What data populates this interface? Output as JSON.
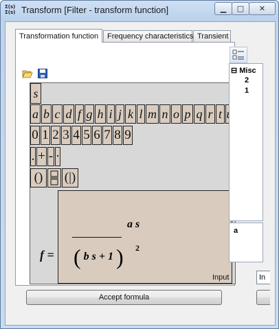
{
  "window": {
    "title": "Transform [Filter - transform function]",
    "app_icon": [
      "Σ(s)",
      "Σ(s)"
    ],
    "controls": {
      "minimize": "▁",
      "maximize": "□",
      "close": "✕"
    }
  },
  "tabs": [
    {
      "label": "Transformation function",
      "active": true
    },
    {
      "label": "Frequency characteristics",
      "active": false
    },
    {
      "label": "Transient",
      "active": false
    }
  ],
  "toolbar": {
    "open_icon": "folder-open-icon",
    "save_icon": "save-icon"
  },
  "palette": {
    "variable_row": [
      "s"
    ],
    "letters_row": [
      "a",
      "b",
      "c",
      "d",
      "f",
      "g",
      "h",
      "i",
      "j",
      "k",
      "l",
      "m",
      "n",
      "o",
      "p",
      "q",
      "r",
      "t",
      "u"
    ],
    "digits_row": [
      "0",
      "1",
      "2",
      "3",
      "4",
      "5",
      "6",
      "7",
      "8",
      "9"
    ],
    "operators_row": [
      ".",
      "+",
      "-",
      "·"
    ],
    "structures_row": [
      "()",
      "▭/▭",
      "(|)"
    ]
  },
  "formula": {
    "lhs": "f =",
    "numerator": "a s",
    "denominator_open": "(",
    "denominator_body": "b s + 1",
    "denominator_close": ")",
    "exponent": "2"
  },
  "property_grid": {
    "category": "Misc",
    "collapse_symbol": "⊟",
    "values": [
      "2",
      "1"
    ]
  },
  "description": {
    "text": "a"
  },
  "input": {
    "label": "Input",
    "value": "In"
  },
  "buttons": {
    "accept": "Accept formula"
  }
}
